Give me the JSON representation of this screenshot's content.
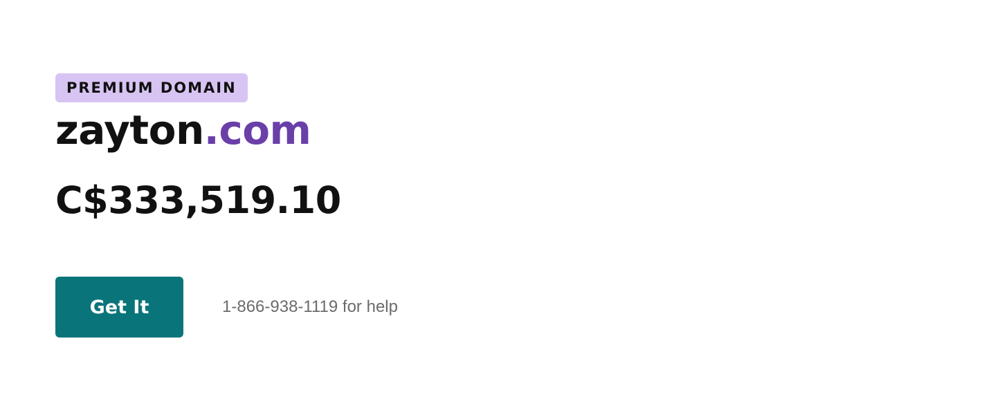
{
  "badge": {
    "label": "PREMIUM DOMAIN",
    "background": "#d8c4f3"
  },
  "domain": {
    "name": "zayton",
    "tld": ".com",
    "name_color": "#111111",
    "tld_color": "#6a3fa8"
  },
  "price": {
    "text": "C$333,519.10"
  },
  "cta": {
    "label": "Get It",
    "background": "#09757a"
  },
  "help": {
    "phone": "1-866-938-1119",
    "suffix": " for help"
  }
}
